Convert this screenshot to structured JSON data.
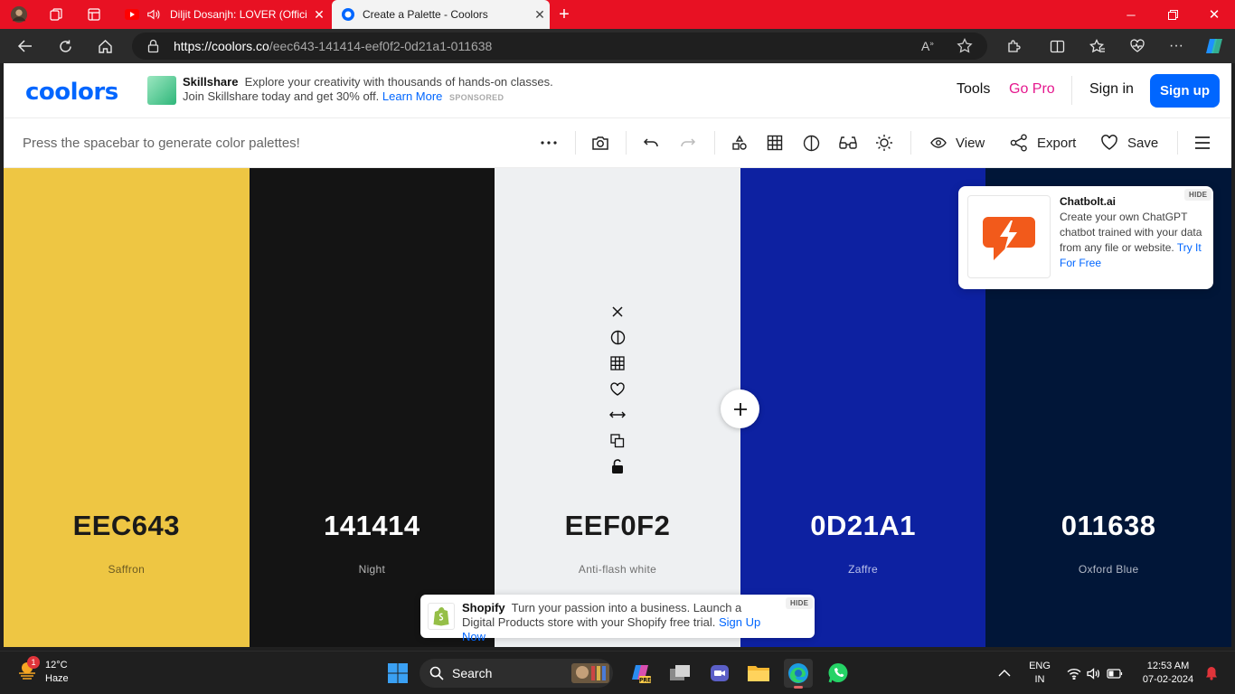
{
  "browser": {
    "tabs": [
      {
        "title": "Diljit Dosanjh: LOVER (Offici",
        "active": false
      },
      {
        "title": "Create a Palette - Coolors",
        "active": true
      }
    ],
    "url_host": "https://coolors.co",
    "url_path": "/eec643-141414-eef0f2-0d21a1-011638"
  },
  "header": {
    "logo": "coolors",
    "ad": {
      "brand": "Skillshare",
      "text": "Explore your creativity with thousands of hands-on classes. Join Skillshare today and get 30% off.",
      "link": "Learn More",
      "sponsored": "SPONSORED"
    },
    "nav": {
      "tools": "Tools",
      "go_pro": "Go Pro",
      "sign_in": "Sign in",
      "sign_up": "Sign up"
    }
  },
  "toolbar": {
    "hint": "Press the spacebar to generate color palettes!",
    "view": "View",
    "export": "Export",
    "save": "Save"
  },
  "palette": [
    {
      "hex": "EEC643",
      "name": "Saffron",
      "color": "#eec643",
      "text_color": "#1a1a1a",
      "name_color": "#6b5a22"
    },
    {
      "hex": "141414",
      "name": "Night",
      "color": "#141414",
      "text_color": "#ffffff",
      "name_color": "#b5b5b5"
    },
    {
      "hex": "EEF0F2",
      "name": "Anti-flash white",
      "color": "#eef0f2",
      "text_color": "#1a1a1a",
      "name_color": "#707070"
    },
    {
      "hex": "0D21A1",
      "name": "Zaffre",
      "color": "#0d21a1",
      "text_color": "#ffffff",
      "name_color": "#b9c0ea"
    },
    {
      "hex": "011638",
      "name": "Oxford Blue",
      "color": "#011638",
      "text_color": "#ffffff",
      "name_color": "#b1b8c6"
    }
  ],
  "chat_ad": {
    "brand": "Chatbolt.ai",
    "text": "Create your own ChatGPT chatbot trained with your data from any file or website.",
    "link": "Try It For Free",
    "hide": "HIDE"
  },
  "shop_ad": {
    "brand": "Shopify",
    "text": "Turn your passion into a business. Launch a Digital Products store with your Shopify free trial.",
    "link": "Sign Up Now",
    "hide": "HIDE"
  },
  "taskbar": {
    "weather_temp": "12°C",
    "weather_desc": "Haze",
    "weather_badge": "1",
    "search": "Search",
    "lang_1": "ENG",
    "lang_2": "IN",
    "time": "12:53 AM",
    "date": "07-02-2024"
  }
}
